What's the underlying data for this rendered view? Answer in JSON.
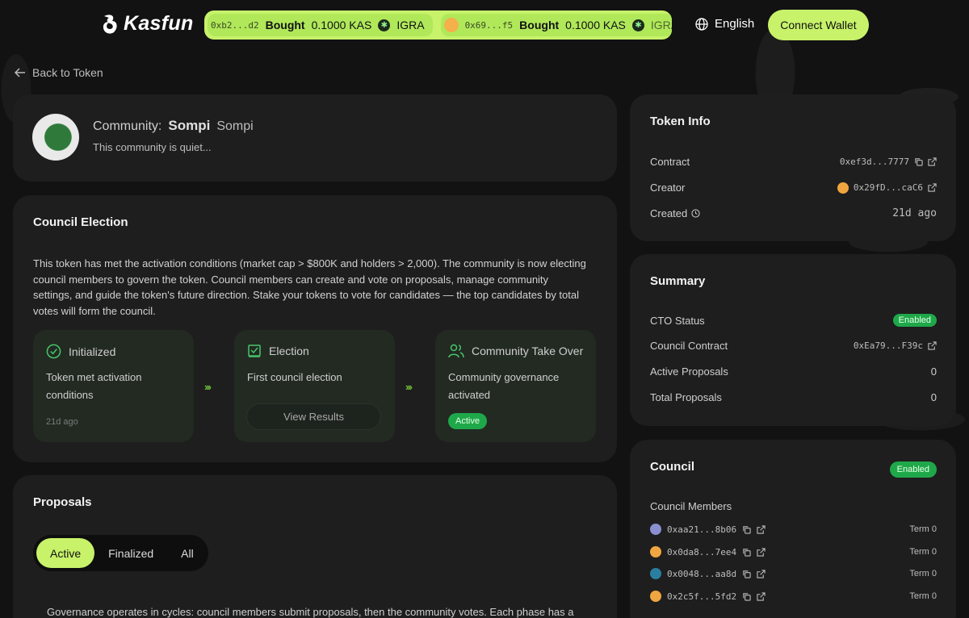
{
  "header": {
    "logo": "Kasfun",
    "ticker": [
      {
        "addr": "0xb2...d2",
        "action": "Bought",
        "amount": "0.1000 KAS",
        "token": "IGRA"
      },
      {
        "addr": "0x69...f5",
        "action": "Bought",
        "amount": "0.1000 KAS",
        "token": "IGRA"
      }
    ],
    "language": "English",
    "connect": "Connect Wallet"
  },
  "back": "Back to Token",
  "community": {
    "label": "Community:",
    "name": "Sompi",
    "symbol": "Sompi",
    "description": "This community is quiet..."
  },
  "election": {
    "title": "Council Election",
    "description": "This token has met the activation conditions (market cap > $800K and holders > 2,000). The community is now electing council members to govern the token. Council members can create and vote on proposals, manage community settings, and guide the token's future direction. Stake your tokens to vote for candidates — the top candidates by total votes will form the council.",
    "stages": [
      {
        "title": "Initialized",
        "desc": "Token met activation conditions",
        "time": "21d ago"
      },
      {
        "title": "Election",
        "desc": "First council election",
        "button": "View Results"
      },
      {
        "title": "Community Take Over",
        "desc": "Community governance activated",
        "badge": "Active"
      }
    ]
  },
  "proposals": {
    "title": "Proposals",
    "tabs": [
      "Active",
      "Finalized",
      "All"
    ],
    "description": "Governance operates in cycles: council members submit proposals, then the community votes. Each phase has a"
  },
  "token_info": {
    "title": "Token Info",
    "contract_label": "Contract",
    "contract": "0xef3d...7777",
    "creator_label": "Creator",
    "creator": "0x29fD...caC6",
    "created_label": "Created",
    "created": "21d ago"
  },
  "summary": {
    "title": "Summary",
    "cto_label": "CTO Status",
    "cto": "Enabled",
    "council_contract_label": "Council Contract",
    "council_contract": "0xEa79...F39c",
    "active_label": "Active Proposals",
    "active": "0",
    "total_label": "Total Proposals",
    "total": "0"
  },
  "council": {
    "title": "Council",
    "status": "Enabled",
    "members_label": "Council Members",
    "members": [
      {
        "addr": "0xaa21...8b06",
        "term": "Term 0",
        "color": "#8a8fd0"
      },
      {
        "addr": "0x0da8...7ee4",
        "term": "Term 0",
        "color": "#f0a640"
      },
      {
        "addr": "0x0048...aa8d",
        "term": "Term 0",
        "color": "#2a7fa0"
      },
      {
        "addr": "0x2c5f...5fd2",
        "term": "Term 0",
        "color": "#f0a640"
      }
    ]
  },
  "colors": {
    "accent": "#c7f26a",
    "badge": "#1fa84a",
    "card": "#1e1e1e",
    "background": "#121212"
  }
}
